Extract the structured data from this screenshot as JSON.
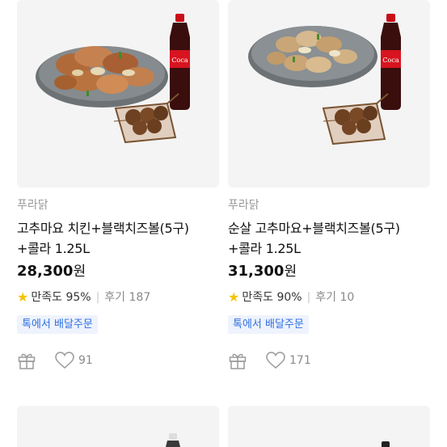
{
  "products": [
    {
      "brand": "푸라닭",
      "title_line1": "고추마요 치킨+블랙치즈볼(5구)",
      "title_line2": "+콜라 1.25L",
      "price": "28,300",
      "price_unit": "원",
      "satisfaction_label": "만족도",
      "satisfaction": "95%",
      "review_label": "후기",
      "review_count": "187",
      "tag": "톡에서 배달주문",
      "likes": "91",
      "icons": [
        "star-icon",
        "gift-icon",
        "heart-icon"
      ],
      "image": "chicken-plate-with-cola-and-cheese-balls"
    },
    {
      "brand": "푸라닭",
      "title_line1": "순살 고추마요+블랙치즈볼(5구)",
      "title_line2": "+콜라 1.25L",
      "price": "31,300",
      "price_unit": "원",
      "satisfaction_label": "만족도",
      "satisfaction": "90%",
      "review_label": "후기",
      "review_count": "10",
      "tag": "톡에서 배달주문",
      "likes": "171",
      "icons": [
        "star-icon",
        "gift-icon",
        "heart-icon"
      ],
      "image": "boneless-chicken-plate-with-cola-and-cheese-balls"
    }
  ],
  "colors": {
    "star": "#f5c400",
    "tag_text": "#2f6fe0",
    "tag_bg": "#eef3fd",
    "muted": "#8a8a8a"
  }
}
